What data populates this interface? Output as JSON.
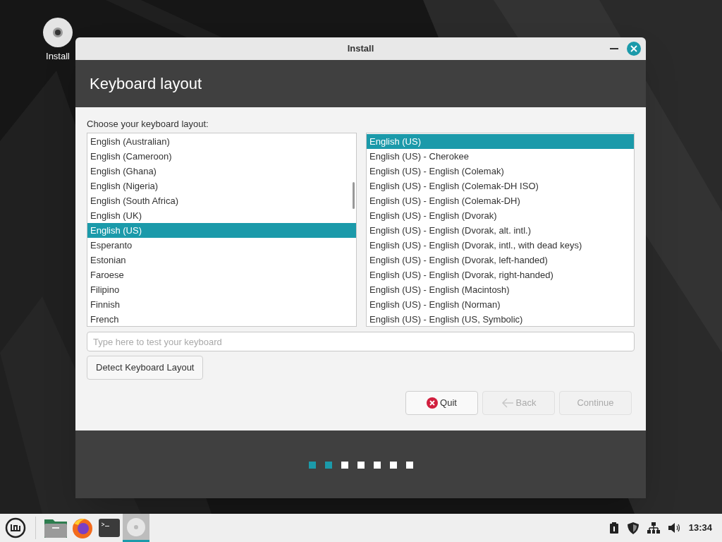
{
  "desktop": {
    "icons": [
      {
        "label": "Install"
      }
    ]
  },
  "window": {
    "title": "Install",
    "heading": "Keyboard layout",
    "prompt": "Choose your keyboard layout:",
    "layouts": [
      {
        "label": "English (Australian)",
        "selected": false
      },
      {
        "label": "English (Cameroon)",
        "selected": false
      },
      {
        "label": "English (Ghana)",
        "selected": false
      },
      {
        "label": "English (Nigeria)",
        "selected": false
      },
      {
        "label": "English (South Africa)",
        "selected": false
      },
      {
        "label": "English (UK)",
        "selected": false
      },
      {
        "label": "English (US)",
        "selected": true
      },
      {
        "label": "Esperanto",
        "selected": false
      },
      {
        "label": "Estonian",
        "selected": false
      },
      {
        "label": "Faroese",
        "selected": false
      },
      {
        "label": "Filipino",
        "selected": false
      },
      {
        "label": "Finnish",
        "selected": false
      },
      {
        "label": "French",
        "selected": false
      }
    ],
    "variants": [
      {
        "label": "English (US)",
        "selected": true
      },
      {
        "label": "English (US) - Cherokee",
        "selected": false
      },
      {
        "label": "English (US) - English (Colemak)",
        "selected": false
      },
      {
        "label": "English (US) - English (Colemak-DH ISO)",
        "selected": false
      },
      {
        "label": "English (US) - English (Colemak-DH)",
        "selected": false
      },
      {
        "label": "English (US) - English (Dvorak)",
        "selected": false
      },
      {
        "label": "English (US) - English (Dvorak, alt. intl.)",
        "selected": false
      },
      {
        "label": "English (US) - English (Dvorak, intl., with dead keys)",
        "selected": false
      },
      {
        "label": "English (US) - English (Dvorak, left-handed)",
        "selected": false
      },
      {
        "label": "English (US) - English (Dvorak, right-handed)",
        "selected": false
      },
      {
        "label": "English (US) - English (Macintosh)",
        "selected": false
      },
      {
        "label": "English (US) - English (Norman)",
        "selected": false
      },
      {
        "label": "English (US) - English (US, Symbolic)",
        "selected": false
      }
    ],
    "test_field": {
      "placeholder": "Type here to test your keyboard"
    },
    "detect_button": "Detect Keyboard Layout",
    "buttons": [
      {
        "kind": "quit",
        "label": "Quit",
        "disabled": false
      },
      {
        "kind": "back",
        "label": "Back",
        "disabled": true
      },
      {
        "kind": "continue",
        "label": "Continue",
        "disabled": true
      }
    ],
    "steps": [
      {
        "done": true
      },
      {
        "done": true
      },
      {
        "done": false
      },
      {
        "done": false
      },
      {
        "done": false
      },
      {
        "done": false
      },
      {
        "done": false
      }
    ]
  },
  "taskbar": {
    "launchers": [
      {
        "kind": "files",
        "active": false
      },
      {
        "kind": "browser",
        "active": false
      },
      {
        "kind": "terminal",
        "active": false
      },
      {
        "kind": "disc",
        "active": true
      }
    ],
    "clock": "13:34"
  }
}
